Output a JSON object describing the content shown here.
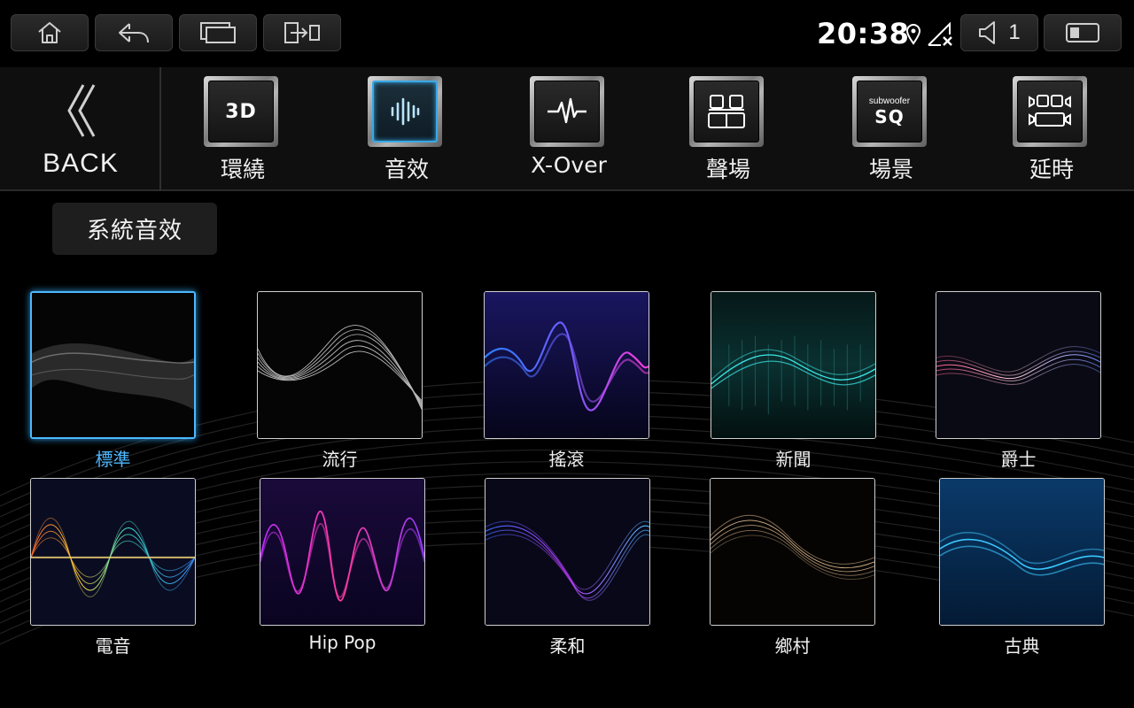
{
  "statusbar": {
    "clock": "20:38",
    "volume_level": "1",
    "nav_buttons": [
      {
        "name": "home-button",
        "icon": "home-icon"
      },
      {
        "name": "back-nav-button",
        "icon": "return-arrow-icon"
      },
      {
        "name": "recent-apps-button",
        "icon": "recent-apps-icon"
      },
      {
        "name": "screen-switch-button",
        "icon": "screen-switch-icon"
      }
    ]
  },
  "toolbar": {
    "back_label": "BACK",
    "tools": [
      {
        "label": "環繞",
        "icon": "3d-surround-icon",
        "icon_text": "3D",
        "active": false
      },
      {
        "label": "音效",
        "icon": "equalizer-icon",
        "active": true
      },
      {
        "label": "X-Over",
        "icon": "waveform-icon",
        "active": false
      },
      {
        "label": "聲場",
        "icon": "seats-icon",
        "active": false
      },
      {
        "label": "場景",
        "icon": "subwoofer-sq-icon",
        "icon_text_small": "subwoofer",
        "icon_text": "SQ",
        "active": false
      },
      {
        "label": "延時",
        "icon": "speaker-delay-icon",
        "active": false
      }
    ]
  },
  "section": {
    "title": "系統音效"
  },
  "presets": [
    {
      "label": "標準",
      "selected": true
    },
    {
      "label": "流行",
      "selected": false
    },
    {
      "label": "搖滾",
      "selected": false
    },
    {
      "label": "新聞",
      "selected": false
    },
    {
      "label": "爵士",
      "selected": false
    },
    {
      "label": "電音",
      "selected": false
    },
    {
      "label": "Hip Pop",
      "selected": false
    },
    {
      "label": "柔和",
      "selected": false
    },
    {
      "label": "鄉村",
      "selected": false
    },
    {
      "label": "古典",
      "selected": false
    }
  ],
  "colors": {
    "accent": "#4db8ff",
    "background": "#000000",
    "toolbar_bg": "#0f0f0f"
  }
}
